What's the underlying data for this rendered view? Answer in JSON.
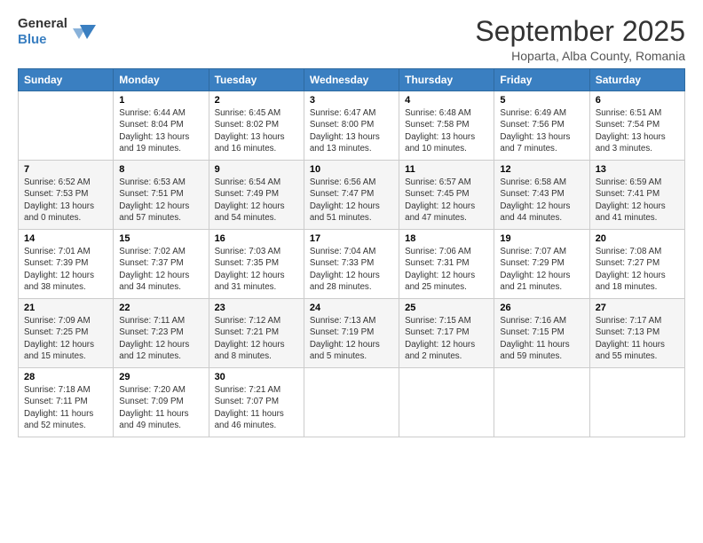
{
  "header": {
    "logo_general": "General",
    "logo_blue": "Blue",
    "title": "September 2025",
    "subtitle": "Hoparta, Alba County, Romania"
  },
  "weekdays": [
    "Sunday",
    "Monday",
    "Tuesday",
    "Wednesday",
    "Thursday",
    "Friday",
    "Saturday"
  ],
  "weeks": [
    [
      {
        "day": "",
        "info": ""
      },
      {
        "day": "1",
        "info": "Sunrise: 6:44 AM\nSunset: 8:04 PM\nDaylight: 13 hours\nand 19 minutes."
      },
      {
        "day": "2",
        "info": "Sunrise: 6:45 AM\nSunset: 8:02 PM\nDaylight: 13 hours\nand 16 minutes."
      },
      {
        "day": "3",
        "info": "Sunrise: 6:47 AM\nSunset: 8:00 PM\nDaylight: 13 hours\nand 13 minutes."
      },
      {
        "day": "4",
        "info": "Sunrise: 6:48 AM\nSunset: 7:58 PM\nDaylight: 13 hours\nand 10 minutes."
      },
      {
        "day": "5",
        "info": "Sunrise: 6:49 AM\nSunset: 7:56 PM\nDaylight: 13 hours\nand 7 minutes."
      },
      {
        "day": "6",
        "info": "Sunrise: 6:51 AM\nSunset: 7:54 PM\nDaylight: 13 hours\nand 3 minutes."
      }
    ],
    [
      {
        "day": "7",
        "info": "Sunrise: 6:52 AM\nSunset: 7:53 PM\nDaylight: 13 hours\nand 0 minutes."
      },
      {
        "day": "8",
        "info": "Sunrise: 6:53 AM\nSunset: 7:51 PM\nDaylight: 12 hours\nand 57 minutes."
      },
      {
        "day": "9",
        "info": "Sunrise: 6:54 AM\nSunset: 7:49 PM\nDaylight: 12 hours\nand 54 minutes."
      },
      {
        "day": "10",
        "info": "Sunrise: 6:56 AM\nSunset: 7:47 PM\nDaylight: 12 hours\nand 51 minutes."
      },
      {
        "day": "11",
        "info": "Sunrise: 6:57 AM\nSunset: 7:45 PM\nDaylight: 12 hours\nand 47 minutes."
      },
      {
        "day": "12",
        "info": "Sunrise: 6:58 AM\nSunset: 7:43 PM\nDaylight: 12 hours\nand 44 minutes."
      },
      {
        "day": "13",
        "info": "Sunrise: 6:59 AM\nSunset: 7:41 PM\nDaylight: 12 hours\nand 41 minutes."
      }
    ],
    [
      {
        "day": "14",
        "info": "Sunrise: 7:01 AM\nSunset: 7:39 PM\nDaylight: 12 hours\nand 38 minutes."
      },
      {
        "day": "15",
        "info": "Sunrise: 7:02 AM\nSunset: 7:37 PM\nDaylight: 12 hours\nand 34 minutes."
      },
      {
        "day": "16",
        "info": "Sunrise: 7:03 AM\nSunset: 7:35 PM\nDaylight: 12 hours\nand 31 minutes."
      },
      {
        "day": "17",
        "info": "Sunrise: 7:04 AM\nSunset: 7:33 PM\nDaylight: 12 hours\nand 28 minutes."
      },
      {
        "day": "18",
        "info": "Sunrise: 7:06 AM\nSunset: 7:31 PM\nDaylight: 12 hours\nand 25 minutes."
      },
      {
        "day": "19",
        "info": "Sunrise: 7:07 AM\nSunset: 7:29 PM\nDaylight: 12 hours\nand 21 minutes."
      },
      {
        "day": "20",
        "info": "Sunrise: 7:08 AM\nSunset: 7:27 PM\nDaylight: 12 hours\nand 18 minutes."
      }
    ],
    [
      {
        "day": "21",
        "info": "Sunrise: 7:09 AM\nSunset: 7:25 PM\nDaylight: 12 hours\nand 15 minutes."
      },
      {
        "day": "22",
        "info": "Sunrise: 7:11 AM\nSunset: 7:23 PM\nDaylight: 12 hours\nand 12 minutes."
      },
      {
        "day": "23",
        "info": "Sunrise: 7:12 AM\nSunset: 7:21 PM\nDaylight: 12 hours\nand 8 minutes."
      },
      {
        "day": "24",
        "info": "Sunrise: 7:13 AM\nSunset: 7:19 PM\nDaylight: 12 hours\nand 5 minutes."
      },
      {
        "day": "25",
        "info": "Sunrise: 7:15 AM\nSunset: 7:17 PM\nDaylight: 12 hours\nand 2 minutes."
      },
      {
        "day": "26",
        "info": "Sunrise: 7:16 AM\nSunset: 7:15 PM\nDaylight: 11 hours\nand 59 minutes."
      },
      {
        "day": "27",
        "info": "Sunrise: 7:17 AM\nSunset: 7:13 PM\nDaylight: 11 hours\nand 55 minutes."
      }
    ],
    [
      {
        "day": "28",
        "info": "Sunrise: 7:18 AM\nSunset: 7:11 PM\nDaylight: 11 hours\nand 52 minutes."
      },
      {
        "day": "29",
        "info": "Sunrise: 7:20 AM\nSunset: 7:09 PM\nDaylight: 11 hours\nand 49 minutes."
      },
      {
        "day": "30",
        "info": "Sunrise: 7:21 AM\nSunset: 7:07 PM\nDaylight: 11 hours\nand 46 minutes."
      },
      {
        "day": "",
        "info": ""
      },
      {
        "day": "",
        "info": ""
      },
      {
        "day": "",
        "info": ""
      },
      {
        "day": "",
        "info": ""
      }
    ]
  ]
}
